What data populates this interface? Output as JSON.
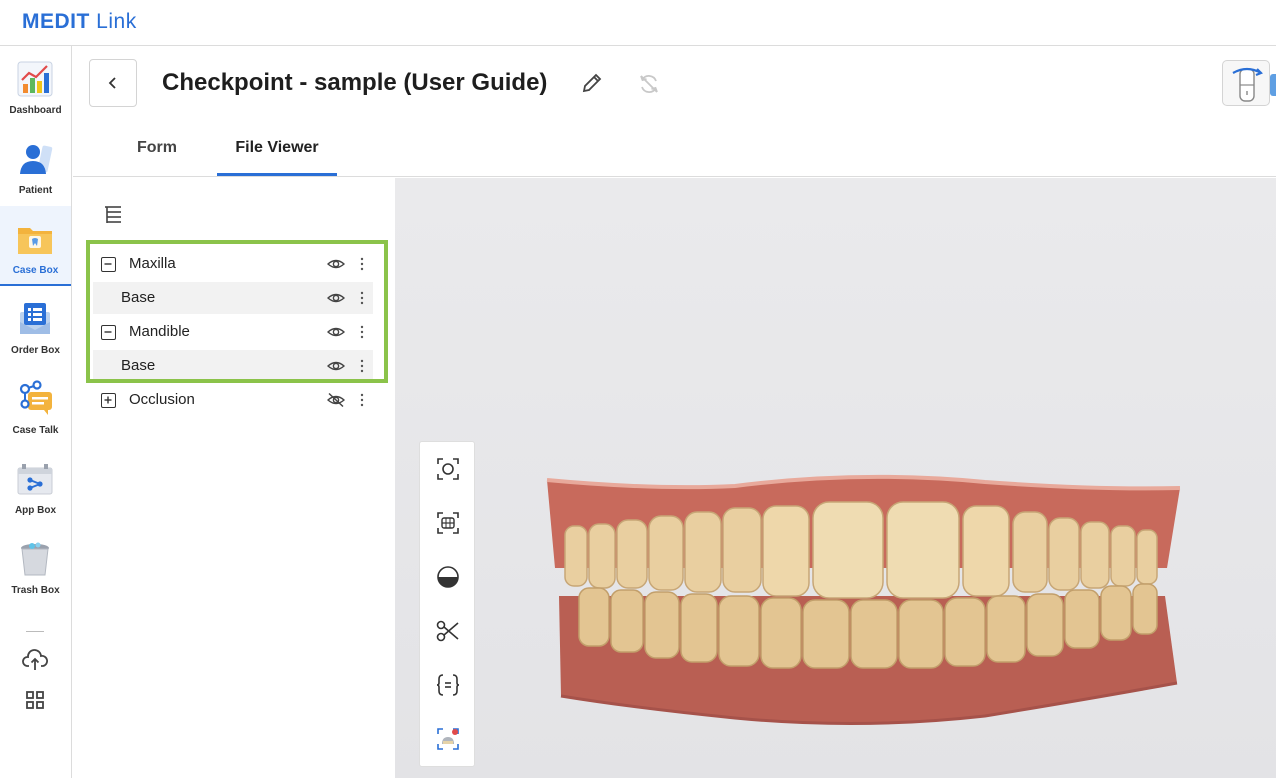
{
  "app": {
    "brand_main": "MEDIT",
    "brand_sub": "Link"
  },
  "nav": {
    "items": [
      {
        "id": "dashboard",
        "label": "Dashboard",
        "icon": "dashboard-chart-icon"
      },
      {
        "id": "patient",
        "label": "Patient",
        "icon": "patient-icon"
      },
      {
        "id": "case-box",
        "label": "Case Box",
        "icon": "case-box-folder-icon",
        "active": true
      },
      {
        "id": "order-box",
        "label": "Order Box",
        "icon": "order-box-icon"
      },
      {
        "id": "case-talk",
        "label": "Case Talk",
        "icon": "case-talk-icon"
      },
      {
        "id": "app-box",
        "label": "App Box",
        "icon": "app-box-icon"
      },
      {
        "id": "trash-box",
        "label": "Trash Box",
        "icon": "trash-box-icon"
      }
    ],
    "utilities": [
      "cloud-upload-icon",
      "grid-apps-icon"
    ]
  },
  "header": {
    "case_title": "Checkpoint - sample (User Guide)",
    "tabs": [
      {
        "label": "Form",
        "active": false
      },
      {
        "label": "File Viewer",
        "active": true
      }
    ]
  },
  "tree": {
    "rows": [
      {
        "label": "Maxilla",
        "type": "parent",
        "expanded": true,
        "visible": true
      },
      {
        "label": "Base",
        "type": "child",
        "visible": true
      },
      {
        "label": "Mandible",
        "type": "parent",
        "expanded": true,
        "visible": true
      },
      {
        "label": "Base",
        "type": "child",
        "visible": true
      },
      {
        "label": "Occlusion",
        "type": "parent",
        "expanded": false,
        "visible": false
      }
    ]
  },
  "viewer": {
    "tools": [
      "reset-view-icon",
      "fit-view-icon",
      "transparency-icon",
      "clip-icon",
      "measure-icon",
      "screenshot-icon"
    ]
  },
  "colors": {
    "accent": "#2a6fd6",
    "highlight": "#8bc34a",
    "gum": "#c86a5c",
    "tooth": "#e9cfa0"
  }
}
